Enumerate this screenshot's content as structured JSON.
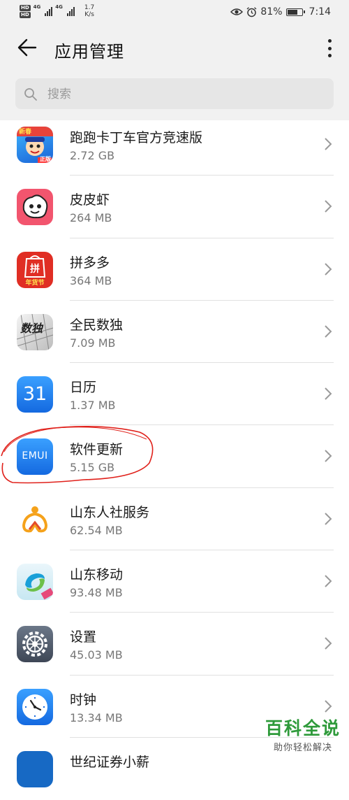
{
  "status_bar": {
    "hd_label": "HD",
    "network_label": "4G",
    "speed_value": "1.7",
    "speed_unit": "K/s",
    "battery": "81%",
    "battery_level": 0.81,
    "time": "7:14"
  },
  "header": {
    "title": "应用管理",
    "back_icon": "arrow-left-icon",
    "more_icon": "more-vertical-icon"
  },
  "search": {
    "placeholder": "搜索",
    "icon": "search-icon"
  },
  "apps": [
    {
      "name": "跑跑卡丁车官方竞速版",
      "size": "2.72 GB",
      "icon": "kartrider-icon",
      "badge": "新春",
      "badge2": "正版"
    },
    {
      "name": "皮皮虾",
      "size": "264 MB",
      "icon": "pipixia-icon"
    },
    {
      "name": "拼多多",
      "size": "364 MB",
      "icon": "pinduoduo-icon",
      "badge": "拼",
      "badge2": "年货节"
    },
    {
      "name": "全民数独",
      "size": "7.09 MB",
      "icon": "sudoku-icon",
      "badge": "数独"
    },
    {
      "name": "日历",
      "size": "1.37 MB",
      "icon": "calendar-icon",
      "badge": "31"
    },
    {
      "name": "软件更新",
      "size": "5.15 GB",
      "icon": "emui-update-icon",
      "badge": "EMUI"
    },
    {
      "name": "山东人社服务",
      "size": "62.54 MB",
      "icon": "shandong-hr-icon"
    },
    {
      "name": "山东移动",
      "size": "93.48 MB",
      "icon": "china-mobile-icon"
    },
    {
      "name": "设置",
      "size": "45.03 MB",
      "icon": "settings-gear-icon"
    },
    {
      "name": "时钟",
      "size": "13.34 MB",
      "icon": "clock-icon"
    },
    {
      "name": "世纪证券小薪",
      "size": "",
      "icon": "securities-icon"
    }
  ],
  "watermark": {
    "main": "百科全说",
    "sub": "助你轻松解决"
  },
  "colors": {
    "background": "#f1f1f1",
    "annotation": "#e0211b",
    "watermark": "#2e9a3a"
  }
}
